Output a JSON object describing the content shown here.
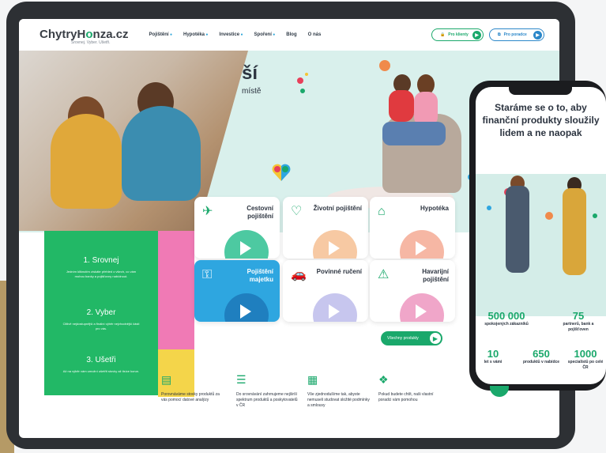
{
  "brand": {
    "logo_main": "ChytryH",
    "logo_accent": "o",
    "logo_end": "nza.cz",
    "tagline": "Srovnej. Vyber. Ušetři."
  },
  "nav": {
    "items": [
      "Pojištění",
      "Hypotéka",
      "Investice",
      "Spoření",
      "Blog",
      "O nás"
    ],
    "clients_label": "Pro klienty",
    "advisors_label": "Pro poradce"
  },
  "hero": {
    "title": "ší",
    "subtitle": "místě"
  },
  "tiles": [
    {
      "label": "Cestovní pojištění",
      "icon": "suitcase-icon",
      "color": "#ffffff",
      "blob": "#4dc9a1"
    },
    {
      "label": "Životní pojištění",
      "icon": "heart-hand-icon",
      "color": "#ffffff",
      "blob": "#f7c9a3"
    },
    {
      "label": "Hypotéka",
      "icon": "house-icon",
      "color": "#ffffff",
      "blob": "#f6b7a4"
    },
    {
      "label": "Pojištění majetku",
      "icon": "key-icon",
      "color": "#2ea6e0",
      "blob": "#1f7fbf"
    },
    {
      "label": "Povinné ručení",
      "icon": "car-icon",
      "color": "#ffffff",
      "blob": "#c7c6ee"
    },
    {
      "label": "Havarijní pojištění",
      "icon": "crash-icon",
      "color": "#ffffff",
      "blob": "#f0a6c9"
    }
  ],
  "steps": [
    {
      "title": "1. Srovnej",
      "desc": "Jedním kliknutím získáte přehled o všech, co vám mohou banky a pojišťovny nabídnout."
    },
    {
      "title": "2. Vyber",
      "desc": "Citlivě nejdostupnější a finální výběr nejvhodnější části pro vás."
    },
    {
      "title": "3. Ušetři",
      "desc": "Až na výběr vám umožní ušetřit stovky až tisíce korun."
    }
  ],
  "all_products_label": "Všechny produkty",
  "features": [
    {
      "icon": "chart-icon",
      "text": "Porovnáváme stovky produktů za vás pomocí datové analýzy"
    },
    {
      "icon": "checklist-icon",
      "text": "Do srovnávání zahrnujeme nejširší spektrum produktů a poskytovatelů v ČR"
    },
    {
      "icon": "document-icon",
      "text": "Vše zjednodušíme tak, abyste nemuseli studovat složité podmínky a smlouvy"
    },
    {
      "icon": "handshake-icon",
      "text": "Pokud budete chtít, naši vlastní poradci vám pomohou"
    }
  ],
  "phone": {
    "title": "Staráme se o to, aby finanční produkty sloužily lidem a ne naopak",
    "stats": [
      {
        "number": "500 000",
        "label": "spokojených zákazníků"
      },
      {
        "number": "75",
        "label": "partnerů, bank a pojišťoven"
      },
      {
        "number": "10",
        "label": "let s vámi"
      },
      {
        "number": "650",
        "label": "produktů v nabídce"
      },
      {
        "number": "1000",
        "label": "specialistů po celé ČR"
      }
    ]
  }
}
